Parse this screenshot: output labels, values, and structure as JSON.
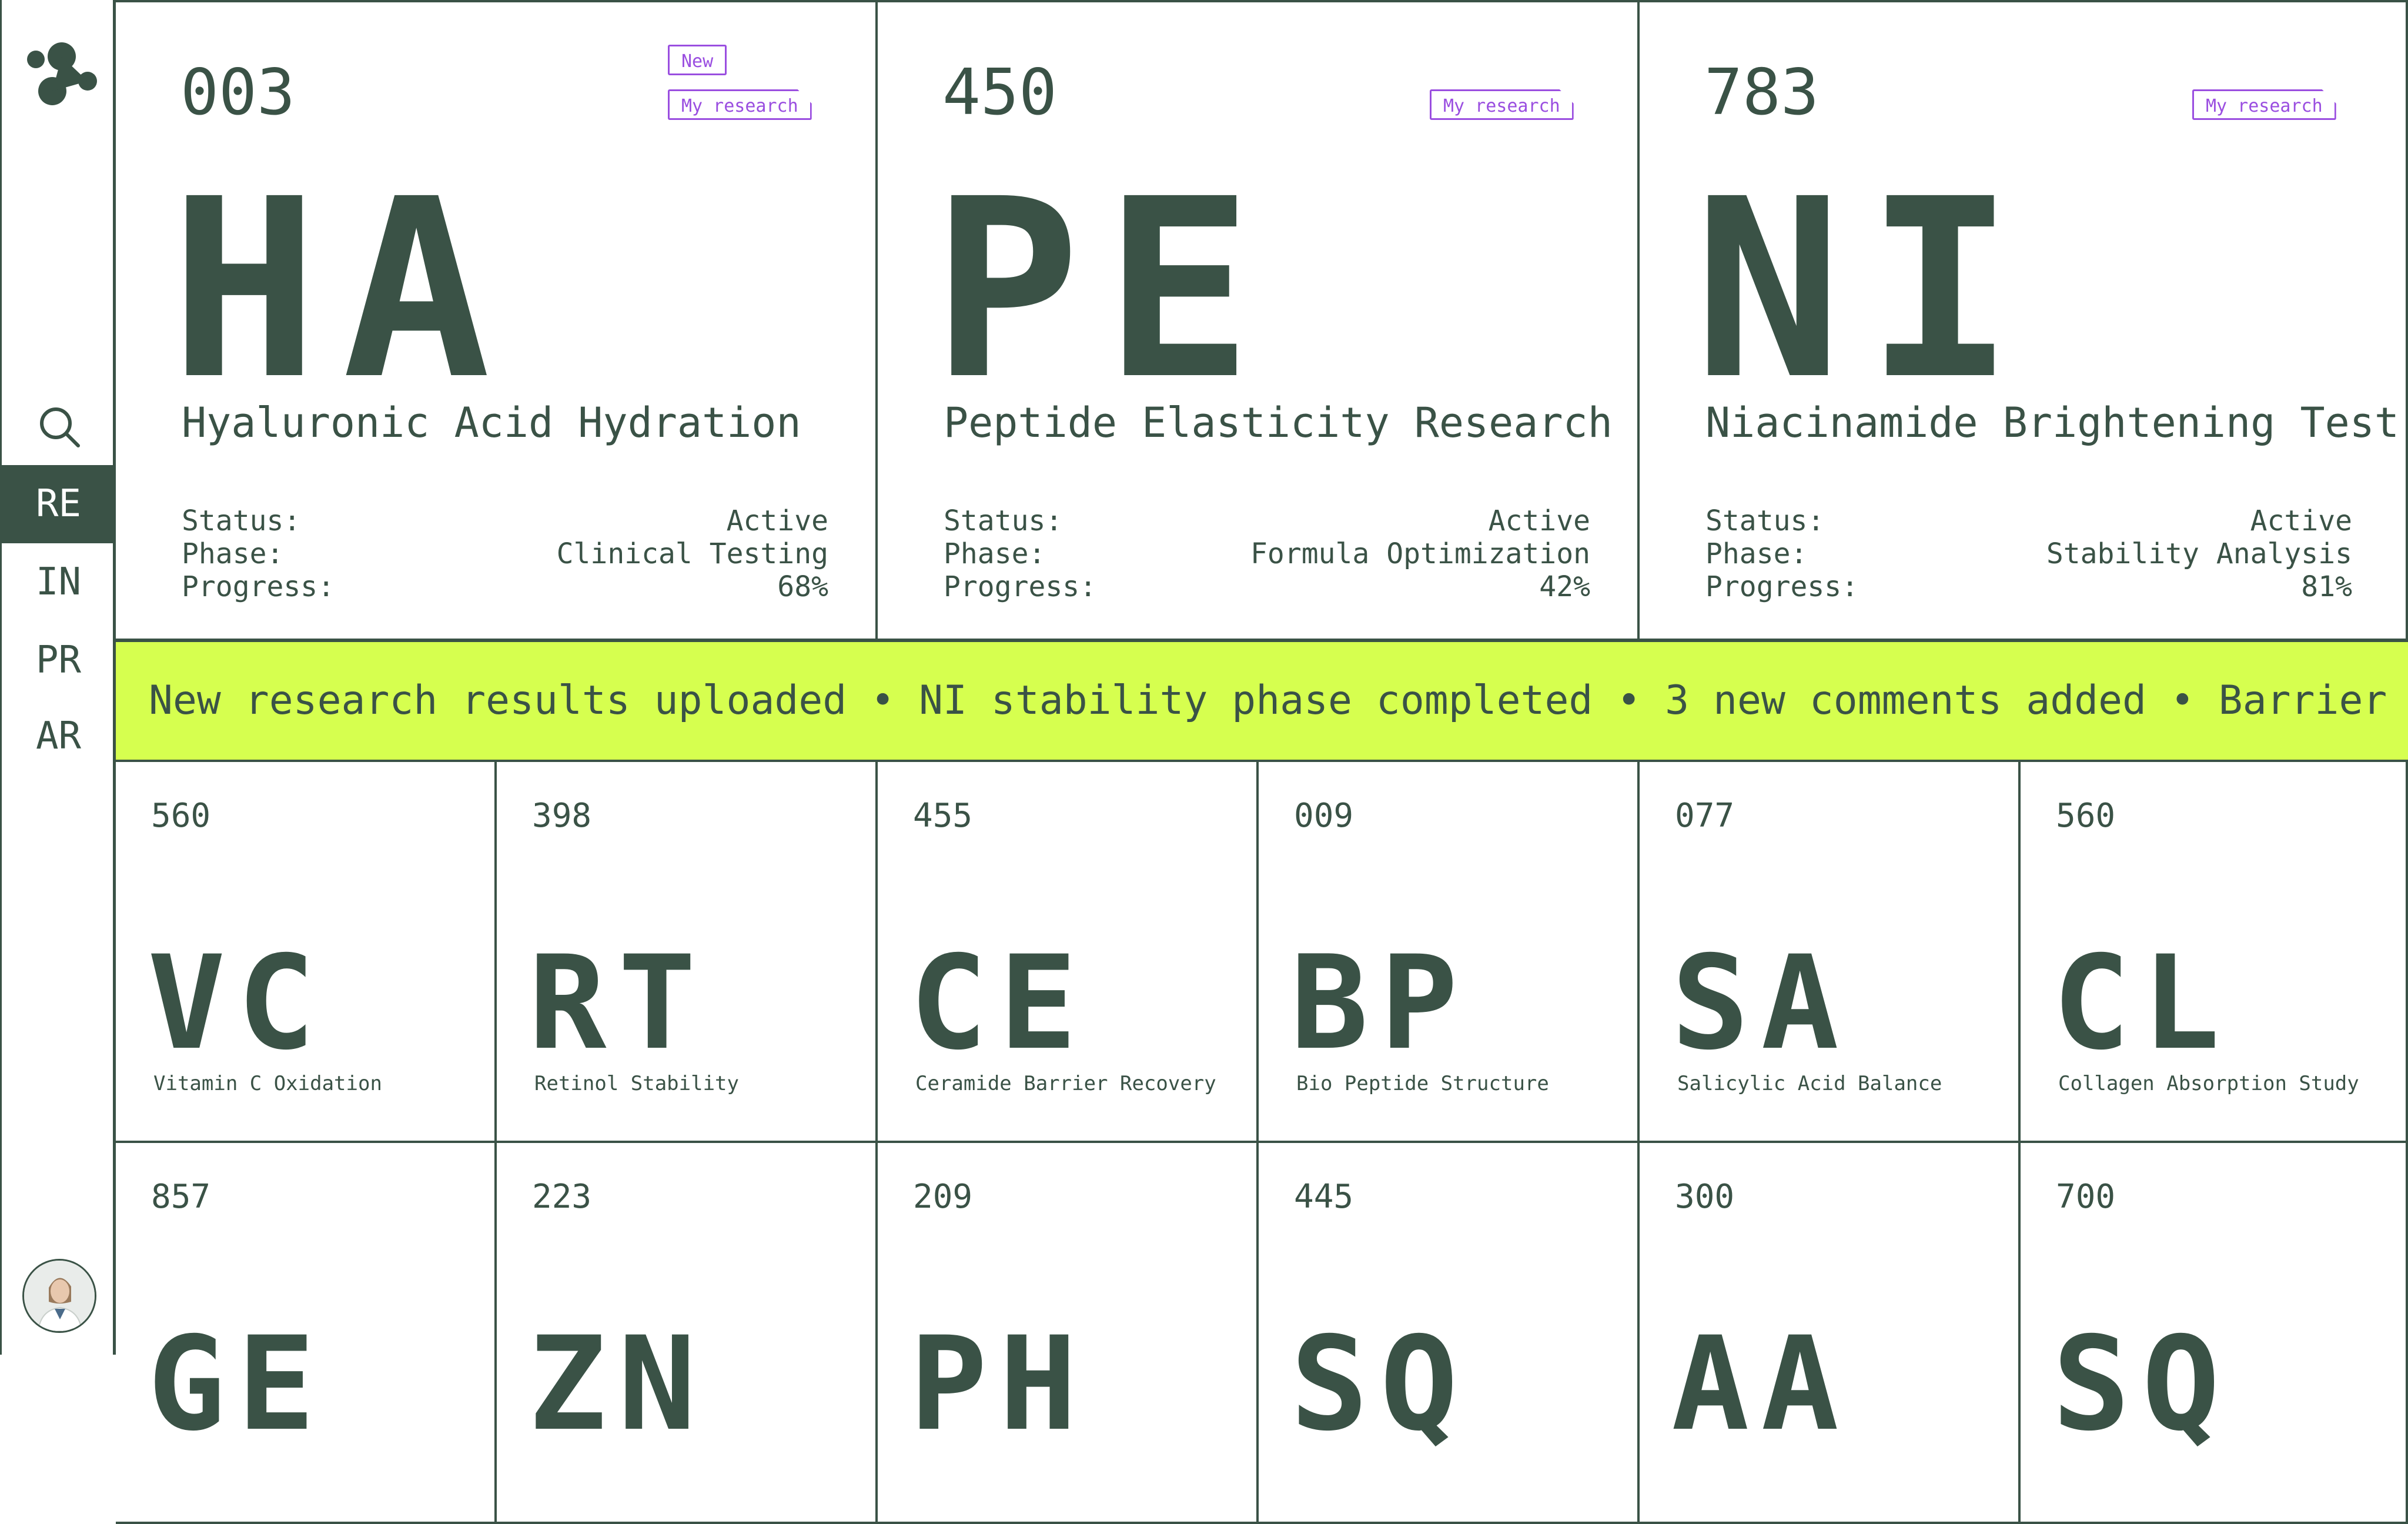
{
  "sidebar": {
    "items": [
      {
        "label": "RE",
        "active": true
      },
      {
        "label": "IN",
        "active": false
      },
      {
        "label": "PR",
        "active": false
      },
      {
        "label": "AR",
        "active": false
      }
    ]
  },
  "featured": [
    {
      "code": "003",
      "abbr": "HA",
      "title": "Hyaluronic Acid Hydration",
      "tags": [
        "New",
        "My research"
      ],
      "status_label": "Status:",
      "status": "Active",
      "phase_label": "Phase:",
      "phase": "Clinical Testing",
      "progress_label": "Progress:",
      "progress": "68%"
    },
    {
      "code": "450",
      "abbr": "PE",
      "title": "Peptide Elasticity Research",
      "tags": [
        "My research"
      ],
      "status_label": "Status:",
      "status": "Active",
      "phase_label": "Phase:",
      "phase": "Formula Optimization",
      "progress_label": "Progress:",
      "progress": "42%"
    },
    {
      "code": "783",
      "abbr": "NI",
      "title": "Niacinamide Brightening Test",
      "tags": [
        "My research"
      ],
      "status_label": "Status:",
      "status": "Active",
      "phase_label": "Phase:",
      "phase": "Stability Analysis",
      "progress_label": "Progress:",
      "progress": "81%"
    }
  ],
  "ticker": {
    "text": "New research results uploaded • NI stability phase completed • 3 new comments added • Barrier Cream"
  },
  "grid": [
    {
      "code": "560",
      "abbr": "VC",
      "name": "Vitamin C Oxidation"
    },
    {
      "code": "398",
      "abbr": "RT",
      "name": "Retinol Stability"
    },
    {
      "code": "455",
      "abbr": "CE",
      "name": "Ceramide Barrier Recovery"
    },
    {
      "code": "009",
      "abbr": "BP",
      "name": "Bio Peptide Structure"
    },
    {
      "code": "077",
      "abbr": "SA",
      "name": "Salicylic Acid Balance"
    },
    {
      "code": "560",
      "abbr": "CL",
      "name": "Collagen Absorption Study"
    },
    {
      "code": "857",
      "abbr": "GE",
      "name": ""
    },
    {
      "code": "223",
      "abbr": "ZN",
      "name": ""
    },
    {
      "code": "209",
      "abbr": "PH",
      "name": ""
    },
    {
      "code": "445",
      "abbr": "SQ",
      "name": ""
    },
    {
      "code": "300",
      "abbr": "AA",
      "name": ""
    },
    {
      "code": "700",
      "abbr": "SQ",
      "name": ""
    }
  ],
  "colors": {
    "primary": "#3a5246",
    "accent": "#d6ff4f",
    "tag": "#9a4ee0"
  },
  "icons": [
    "logo-molecule-icon",
    "search-icon",
    "user-avatar"
  ]
}
